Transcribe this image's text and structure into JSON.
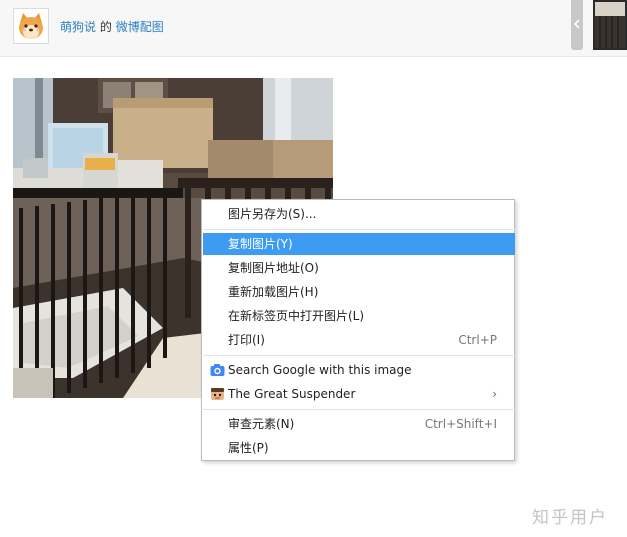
{
  "header": {
    "username": "萌狗说",
    "separator_word": "的",
    "source_link": "微博配图"
  },
  "context_menu": {
    "items": [
      {
        "label": "图片另存为(S)...",
        "shortcut": ""
      },
      {
        "label": "复制图片(Y)",
        "shortcut": "",
        "highlighted": true
      },
      {
        "label": "复制图片地址(O)",
        "shortcut": ""
      },
      {
        "label": "重新加载图片(H)",
        "shortcut": ""
      },
      {
        "label": "在新标签页中打开图片(L)",
        "shortcut": ""
      },
      {
        "label": "打印(I)",
        "shortcut": "Ctrl+P"
      },
      {
        "label": "Search Google with this image",
        "icon": "camera-icon"
      },
      {
        "label": "The Great Suspender",
        "icon": "suspender-icon",
        "submenu_arrow": "›"
      },
      {
        "label": "审查元素(N)",
        "shortcut": "Ctrl+Shift+I"
      },
      {
        "label": "属性(P)",
        "shortcut": ""
      }
    ]
  },
  "watermark": "知乎用户",
  "colors": {
    "highlight": "#3d9cf2",
    "link": "#2d7fc1"
  }
}
